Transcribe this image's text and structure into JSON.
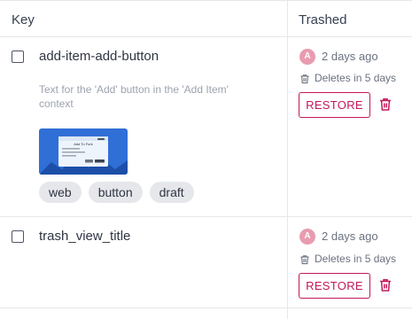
{
  "header": {
    "key_label": "Key",
    "trashed_label": "Trashed"
  },
  "rows": [
    {
      "key": "add-item-add-button",
      "description": "Text for the 'Add' button in the 'Add Item' context",
      "screenshot_title": "Add To Fork",
      "tags": [
        "web",
        "button",
        "draft"
      ],
      "avatar_initial": "A",
      "trashed_ago": "2 days ago",
      "deletes_in": "Deletes in 5 days",
      "restore_label": "RESTORE"
    },
    {
      "key": "trash_view_title",
      "avatar_initial": "A",
      "trashed_ago": "2 days ago",
      "deletes_in": "Deletes in 5 days",
      "restore_label": "RESTORE"
    }
  ],
  "colors": {
    "accent": "#c2185b",
    "avatar": "#e89cb0",
    "border": "#e5e7eb"
  },
  "icons": {
    "trash": "trash-icon",
    "delete": "delete-icon"
  }
}
